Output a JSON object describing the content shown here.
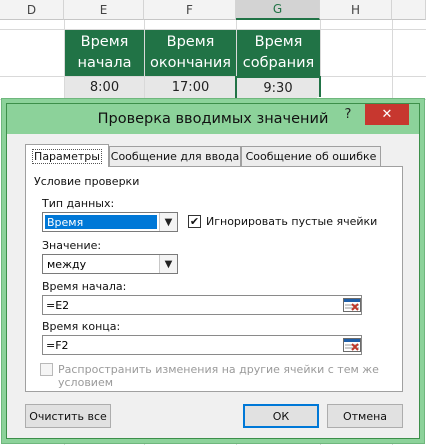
{
  "sheet": {
    "columns": [
      "D",
      "E",
      "F",
      "G",
      "H"
    ],
    "selected_column": "G",
    "header_cells": [
      {
        "col": "E",
        "line1": "Время",
        "line2": "начала"
      },
      {
        "col": "F",
        "line1": "Время",
        "line2": "окончания"
      },
      {
        "col": "G",
        "line1": "Время",
        "line2": "собрания"
      }
    ],
    "value_cells": [
      {
        "col": "E",
        "value": "8:00"
      },
      {
        "col": "F",
        "value": "17:00"
      },
      {
        "col": "G",
        "value": "9:30"
      }
    ],
    "header_color": "#217346"
  },
  "dialog": {
    "title": "Проверка вводимых значений",
    "help_label": "?",
    "close_label": "✕",
    "tabs": [
      "Параметры",
      "Сообщение для ввода",
      "Сообщение об ошибке"
    ],
    "active_tab": "Параметры",
    "group_title": "Условие проверки",
    "data_type_label": "Тип данных:",
    "data_type_value": "Время",
    "ignore_blank_label": "Игнорировать пустые ячейки",
    "ignore_blank_checked": true,
    "data_label": "Значение:",
    "data_value": "между",
    "start_time_label": "Время начала:",
    "start_time_value": "=E2",
    "end_time_label": "Время конца:",
    "end_time_value": "=F2",
    "apply_changes_label_line1": "Распространить изменения на другие ячейки с тем же",
    "apply_changes_label_line2": "условием",
    "apply_changes_checked": false,
    "clear_all_label": "Очистить все",
    "ok_label": "ОК",
    "cancel_label": "Отмена",
    "titlebar_color": "#8cd29a",
    "selection_color": "#0078d7"
  }
}
